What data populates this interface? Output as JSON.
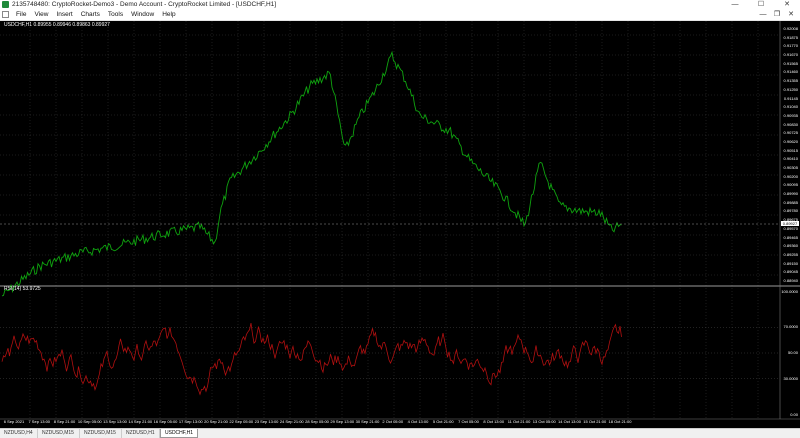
{
  "window": {
    "title": "2135748480: CryptoRocket-Demo3 - Demo Account - CryptoRocket Limited - [USDCHF,H1]",
    "min": "—",
    "max": "☐",
    "close": "✕"
  },
  "menu": {
    "items": [
      "File",
      "View",
      "Insert",
      "Charts",
      "Tools",
      "Window",
      "Help"
    ],
    "mdi": [
      "—",
      "❐",
      "✕"
    ]
  },
  "chart": {
    "label": "USDCHF,H1  0.89955 0.89946 0.89863 0.89927",
    "current_price": "0.89927",
    "price_ticks": [
      "0.92008",
      "0.91875",
      "0.91770",
      "0.91670",
      "0.91565",
      "0.91460",
      "0.91355",
      "0.91250",
      "0.91145",
      "0.91040",
      "0.90935",
      "0.90830",
      "0.90725",
      "0.90620",
      "0.90515",
      "0.90410",
      "0.90305",
      "0.90200",
      "0.90095",
      "0.89990",
      "0.89885",
      "0.89780",
      "0.89675",
      "0.89570",
      "0.89465",
      "0.89360",
      "0.89255",
      "0.89150",
      "0.89045",
      "0.88940"
    ],
    "time_ticks": [
      "6 Sep 2021",
      "7 Sep 13:00",
      "8 Sep 21:00",
      "10 Sep 05:00",
      "13 Sep 13:00",
      "14 Sep 21:00",
      "16 Sep 05:00",
      "17 Sep 13:00",
      "20 Sep 21:00",
      "22 Sep 05:00",
      "23 Sep 13:00",
      "24 Sep 21:00",
      "28 Sep 05:00",
      "29 Sep 13:00",
      "30 Sep 21:00",
      "2 Oct 05:00",
      "4 Oct 13:00",
      "5 Oct 21:00",
      "7 Oct 05:00",
      "8 Oct 13:00",
      "11 Oct 21:00",
      "13 Oct 05:00",
      "14 Oct 13:00",
      "15 Oct 21:00",
      "18 Oct 21:00"
    ]
  },
  "rsi": {
    "label": "RSI(14) 53.9725",
    "ticks": [
      "100.0000",
      "70.0000",
      "50.00",
      "30.0000",
      "0.00"
    ]
  },
  "colors": {
    "price_line": "#0fa30f",
    "rsi_line": "#b01010",
    "grid": "#3a3a3a",
    "background": "#000000"
  },
  "tabs": [
    "NZDUSD,H4",
    "NZDUSD,M15",
    "NZDUSD,M15",
    "NZDUSD,H1",
    "USDCHF,H1"
  ],
  "active_tab": "USDCHF,H1"
}
